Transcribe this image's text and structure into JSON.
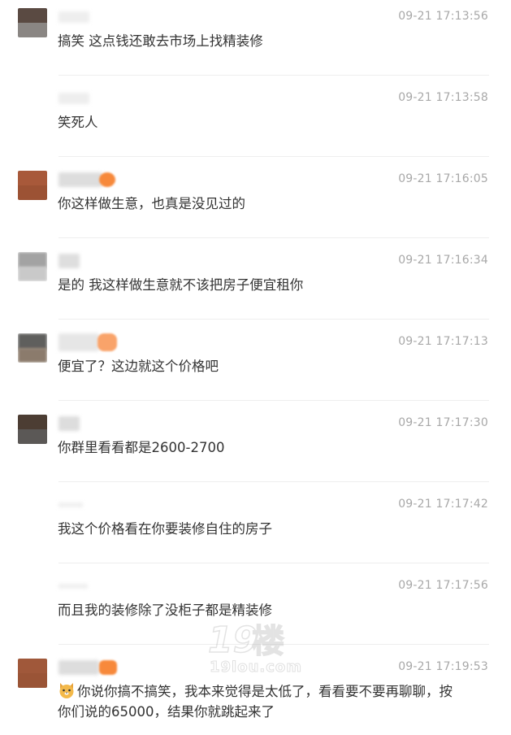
{
  "messages": [
    {
      "time": "09-21 17:13:56",
      "text": "搞笑 这点钱还敢去市场上找精装修",
      "avatar": "dark-photo",
      "name_blur": "short",
      "badge": false
    },
    {
      "time": "09-21 17:13:58",
      "text": "笑死人",
      "avatar": "none",
      "name_blur": "short",
      "badge": false
    },
    {
      "time": "09-21 17:16:05",
      "text": "你这样做生意，也真是没见过的",
      "avatar": "brown-photo",
      "name_blur": "medium",
      "badge": true
    },
    {
      "time": "09-21 17:16:34",
      "text": "是的 我这样做生意就不该把房子便宜租你",
      "avatar": "gray-photo",
      "name_blur": "short",
      "badge": false
    },
    {
      "time": "09-21 17:17:13",
      "text": "便宜了？这边就这个价格吧",
      "avatar": "dark-gray-photo",
      "name_blur": "long",
      "badge": true
    },
    {
      "time": "09-21 17:17:30",
      "text": "你群里看看都是2600-2700",
      "avatar": "dark-brown-photo",
      "name_blur": "short",
      "badge": false
    },
    {
      "time": "09-21 17:17:42",
      "text": "我这个价格看在你要装修自住的房子",
      "avatar": "none",
      "name_blur": "tiny",
      "badge": false
    },
    {
      "time": "09-21 17:17:56",
      "text": "而且我的装修除了没柜子都是精装修",
      "avatar": "none",
      "name_blur": "tiny",
      "badge": false
    },
    {
      "time": "09-21 17:19:53",
      "text": "你说你搞不搞笑，我本来觉得是太低了，看看要不要再聊聊，按你们说的65000，结果你就跳起来了",
      "avatar": "brown-photo",
      "name_blur": "medium",
      "badge": true,
      "emoji": "cat-face"
    }
  ],
  "watermark": {
    "text": "19lou.com"
  },
  "colors": {
    "text": "#333333",
    "time": "#a8a8a8",
    "divider": "#eeeeee",
    "badge": "#f7893b"
  }
}
